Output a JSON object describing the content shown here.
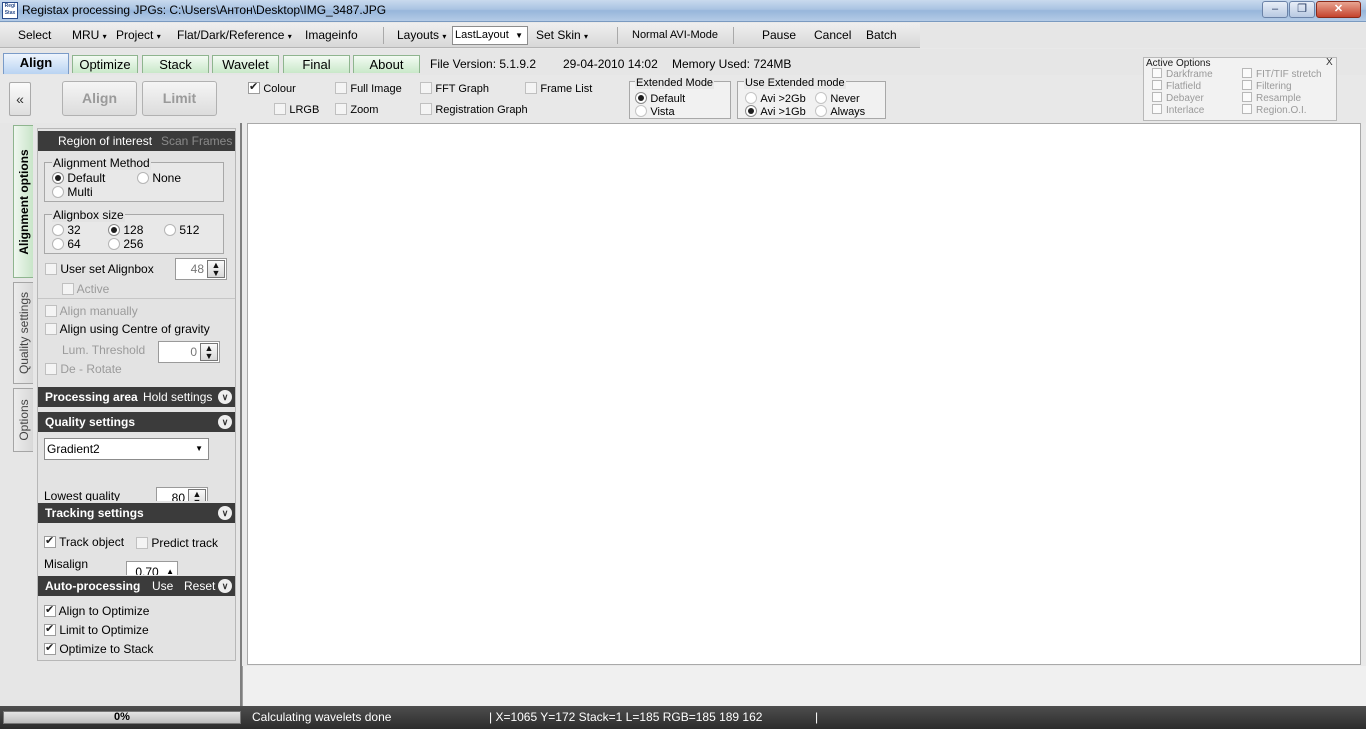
{
  "window": {
    "title": "Registax processing JPGs: C:\\Users\\Антон\\Desktop\\IMG_3487.JPG",
    "icon_text": "Regi Stax"
  },
  "menu": {
    "select": "Select",
    "mru": "MRU",
    "project": "Project",
    "flat": "Flat/Dark/Reference",
    "imageinfo": "Imageinfo",
    "layouts": "Layouts",
    "layout_value": "LastLayout",
    "set_skin": "Set Skin",
    "avi_mode": "Normal AVI-Mode",
    "pause": "Pause",
    "cancel": "Cancel",
    "batch": "Batch"
  },
  "tabs": {
    "align": "Align",
    "optimize": "Optimize",
    "stack": "Stack",
    "wavelet": "Wavelet",
    "final": "Final",
    "about": "About"
  },
  "info": {
    "file_version": "File Version: 5.1.9.2",
    "date": "29-04-2010 14:02",
    "memory": "Memory Used: 724MB"
  },
  "toolbar": {
    "collapse": "«",
    "align_btn": "Align",
    "limit_btn": "Limit",
    "colour": "Colour",
    "lrgb": "LRGB",
    "full_image": "Full Image",
    "zoom": "Zoom",
    "fft_graph": "FFT Graph",
    "registration_graph": "Registration Graph",
    "frame_list": "Frame List",
    "extended_mode": {
      "title": "Extended Mode",
      "default": "Default",
      "vista": "Vista"
    },
    "use_extended": {
      "title": "Use  Extended mode",
      "avi2": "Avi >2Gb",
      "avi1": "Avi >1Gb",
      "never": "Never",
      "always": "Always"
    }
  },
  "active_options": {
    "title": "Active Options",
    "close": "X",
    "items": [
      "Darkframe",
      "Flatfield",
      "Debayer",
      "Interlace",
      "FIT/TIF stretch",
      "Filtering",
      "Resample",
      "Region.O.I."
    ]
  },
  "vtabs": {
    "alignment": "Alignment options",
    "quality": "Quality settings",
    "options": "Options"
  },
  "align_panel": {
    "roi": "Region of interest",
    "scan_frames": "Scan Frames",
    "method_title": "Alignment Method",
    "method_default": "Default",
    "method_none": "None",
    "method_multi": "Multi",
    "alignbox_title": "Alignbox size",
    "size_32": "32",
    "size_128": "128",
    "size_512": "512",
    "size_64": "64",
    "size_256": "256",
    "user_set": "User set Alignbox",
    "user_set_value": "48",
    "active": "Active",
    "align_manually": "Align manually",
    "align_cog": "Align using Centre of gravity",
    "lum_threshold": "Lum. Threshold",
    "lum_value": "0",
    "derotate": "De - Rotate"
  },
  "processing": {
    "title": "Processing area",
    "hold": "Hold settings"
  },
  "quality": {
    "title": "Quality settings",
    "method": "Gradient2",
    "lowest": "Lowest quality",
    "lowest_value": "80"
  },
  "tracking": {
    "title": "Tracking settings",
    "track_object": "Track object",
    "predict_track": "Predict track",
    "misalign": "Misalign",
    "misalign_value": "0.70"
  },
  "auto": {
    "title": "Auto-processing",
    "use": "Use",
    "reset": "Reset",
    "align_to_optimize": "Align to Optimize",
    "limit_to_optimize": "Limit to Optimize",
    "optimize_to_stack": "Optimize to Stack"
  },
  "status": {
    "progress": "0%",
    "message": "Calculating wavelets done",
    "coords": "| X=1065 Y=172 Stack=1 L=185 RGB=185 189 162",
    "sep": "|"
  },
  "colors": {
    "active_tab": "#b9d3f2",
    "green_tab": "#c9e8c9",
    "panel_header": "#3b3b3b",
    "status_bar": "#2c2c2c"
  }
}
